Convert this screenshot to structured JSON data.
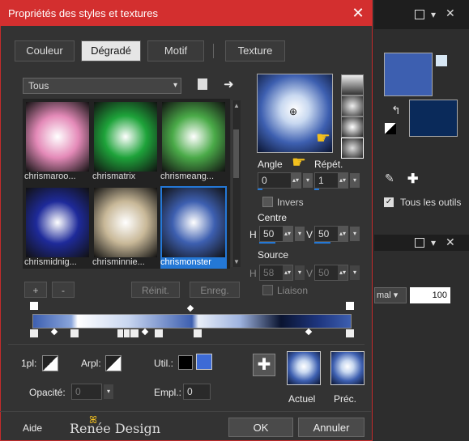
{
  "dialog": {
    "title": "Propriétés des styles et textures",
    "close": "✕"
  },
  "tabs": [
    {
      "label": "Couleur"
    },
    {
      "label": "Dégradé"
    },
    {
      "label": "Motif"
    },
    {
      "label": "Texture"
    }
  ],
  "category": {
    "value": "Tous"
  },
  "gradients": [
    {
      "label": "chrismaroo...",
      "color": "#e48ab8"
    },
    {
      "label": "chrismatrix",
      "color": "#1ea33a"
    },
    {
      "label": "chrismeang...",
      "color": "#4aaa48"
    },
    {
      "label": "chrismidnig...",
      "color": "#1e2a9a"
    },
    {
      "label": "chrisminnie...",
      "color": "#c8b898"
    },
    {
      "label": "chrismonster",
      "color": "#3d5fb0",
      "selected": true
    }
  ],
  "grid_buttons": {
    "add": "+",
    "remove": "-",
    "reset": "Réinit.",
    "save": "Enreg."
  },
  "angle": {
    "label": "Angle",
    "value": "0"
  },
  "repeat": {
    "label": "Répét.",
    "value": "1"
  },
  "invert": {
    "label": "Invers"
  },
  "centre": {
    "label": "Centre",
    "h_label": "H",
    "h_value": "50",
    "v_label": "V",
    "v_value": "50"
  },
  "source": {
    "label": "Source",
    "h_label": "H",
    "h_value": "58",
    "v_label": "V",
    "v_value": "50"
  },
  "link": {
    "label": "Liaison"
  },
  "fields": {
    "first_label": "1pl:",
    "back_label": "Arpl:",
    "util_label": "Util.:",
    "opacity_label": "Opacité:",
    "opacity_value": "0",
    "empl_label": "Empl.:",
    "empl_value": "0"
  },
  "preview": {
    "current_label": "Actuel",
    "previous_label": "Préc."
  },
  "footer": {
    "help": "Aide",
    "logo": "Renée Design",
    "ok": "OK",
    "cancel": "Annuler"
  },
  "right_panel": {
    "tous_outils": "Tous les outils",
    "opacity_value": "100",
    "blend_partial": "mal"
  },
  "colors": {
    "title": "#d32f2f",
    "accent": "#2478d6",
    "navy": "#0a2a5a"
  }
}
